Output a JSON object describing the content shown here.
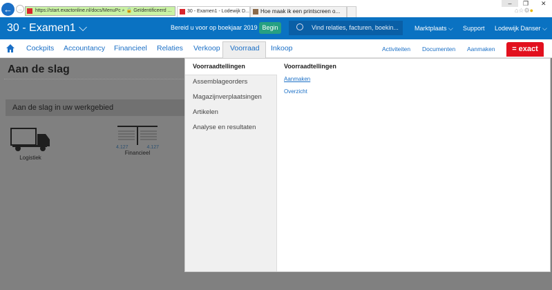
{
  "browser": {
    "url": "https://start.exactonline.nl/docs/MenuPc",
    "cert": "Geïdentificeerd ...",
    "tabs": [
      "30 - Examen1 - Lodewijk D...",
      "Hoe maak ik een printscreen o..."
    ]
  },
  "header": {
    "company": "30 - Examen1 ⌵",
    "promo": "Bereid u voor op boekjaar 2019",
    "begin": "Begin",
    "search_placeholder": "Vind relaties, facturen, boekin...",
    "links": [
      "Marktplaats ⌵",
      "Support",
      "Lodewijk Danser ⌵"
    ]
  },
  "nav": {
    "items": [
      "Cockpits",
      "Accountancy",
      "Financieel",
      "Relaties",
      "Verkoop",
      "Voorraad",
      "Inkoop"
    ],
    "right": [
      "Activiteiten",
      "Documenten",
      "Aanmaken"
    ],
    "logo": "= exact",
    "brand_color": "#e2101e"
  },
  "page": {
    "title": "Aan de slag",
    "section": "Aan de slag in uw werkgebied",
    "tiles": [
      {
        "label": "Logistiek"
      },
      {
        "label": "Financieel",
        "values": [
          "4.127",
          "4.127"
        ]
      }
    ]
  },
  "dropdown": {
    "left_header": "Voorraadtellingen",
    "left_items": [
      "Assemblageorders",
      "Magazijnverplaatsingen",
      "Artikelen",
      "Analyse en resultaten"
    ],
    "right_header": "Voorraadtellingen",
    "right_links": [
      "Aanmaken",
      "Overzicht"
    ]
  }
}
